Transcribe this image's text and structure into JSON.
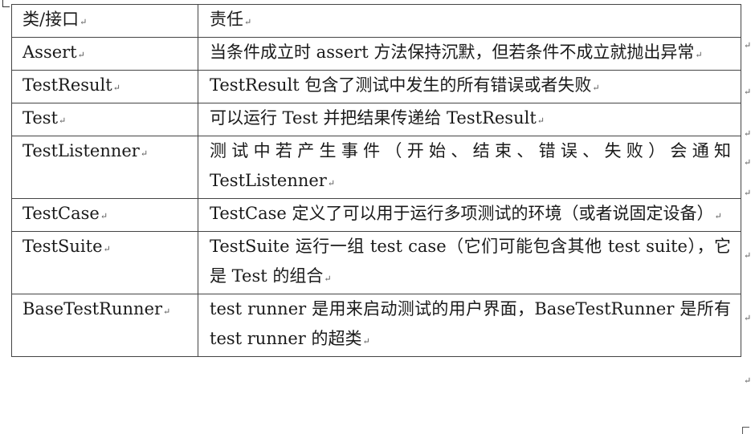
{
  "table": {
    "header": {
      "col1": "类/接口",
      "col2": "责任"
    },
    "rows": [
      {
        "name": "Assert",
        "desc": "当条件成立时 assert 方法保持沉默，但若条件不成立就抛出异常"
      },
      {
        "name": "TestResult",
        "desc": "TestResult 包含了测试中发生的所有错误或者失败"
      },
      {
        "name": "Test",
        "desc": "可以运行 Test 并把结果传递给 TestResult"
      },
      {
        "name": "TestListenner",
        "desc": "测试中若产生事件（开始、结束、错误、失败）会通知 TestListenner"
      },
      {
        "name": "TestCase",
        "desc": "TestCase 定义了可以用于运行多项测试的环境（或者说固定设备）"
      },
      {
        "name": "TestSuite",
        "desc": "TestSuite 运行一组 test case（它们可能包含其他 test suite），它是 Test 的组合"
      },
      {
        "name": "BaseTestRunner",
        "desc": "test runner 是用来启动测试的用户界面，BaseTestRunner 是所有 test runner 的超类"
      }
    ]
  }
}
